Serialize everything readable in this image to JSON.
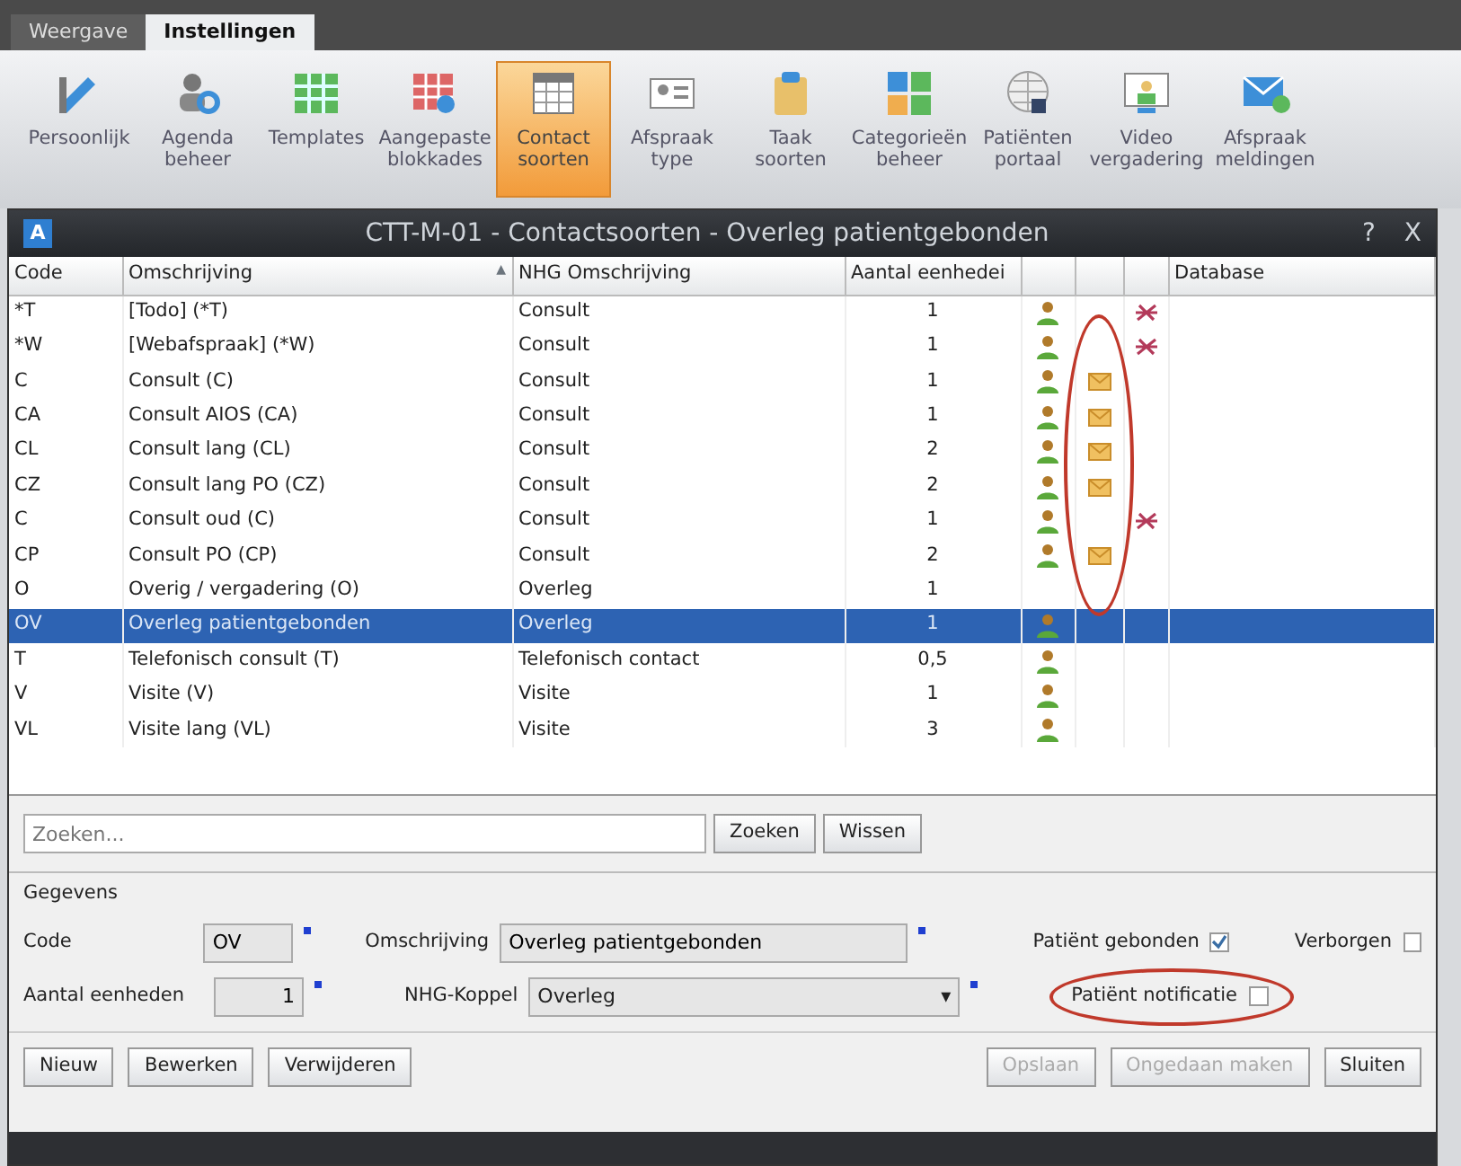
{
  "ribbon": {
    "tabs": [
      {
        "label": "Weergave",
        "selected": false
      },
      {
        "label": "Instellingen",
        "selected": true
      }
    ],
    "items": [
      {
        "label": "Persoonlijk",
        "selected": false
      },
      {
        "label": "Agenda beheer",
        "selected": false
      },
      {
        "label": "Templates",
        "selected": false
      },
      {
        "label": "Aangepaste blokkades",
        "selected": false
      },
      {
        "label": "Contact soorten",
        "selected": true
      },
      {
        "label": "Afspraak type",
        "selected": false
      },
      {
        "label": "Taak soorten",
        "selected": false
      },
      {
        "label": "Categorieën beheer",
        "selected": false
      },
      {
        "label": "Patiënten portaal",
        "selected": false
      },
      {
        "label": "Video vergadering",
        "selected": false
      },
      {
        "label": "Afspraak meldingen",
        "selected": false
      }
    ]
  },
  "dialog": {
    "app_icon": "A",
    "title": "CTT-M-01 - Contactsoorten - Overleg patientgebonden",
    "help": "?",
    "close": "X"
  },
  "table": {
    "columns": [
      {
        "label": "Code"
      },
      {
        "label": "Omschrijving",
        "sort": "▲"
      },
      {
        "label": "NHG Omschrijving"
      },
      {
        "label": "Aantal eenhedei"
      },
      {},
      {},
      {},
      {
        "label": "Database"
      }
    ],
    "rows": [
      {
        "code": "*T",
        "omschrijving": "[Todo] (*T)",
        "nhg": "Consult",
        "aantal": "1",
        "patient": true,
        "mail": false,
        "no_mail": true,
        "selected": false
      },
      {
        "code": "*W",
        "omschrijving": "[Webafspraak] (*W)",
        "nhg": "Consult",
        "aantal": "1",
        "patient": true,
        "mail": false,
        "no_mail": true,
        "selected": false
      },
      {
        "code": "C",
        "omschrijving": "Consult (C)",
        "nhg": "Consult",
        "aantal": "1",
        "patient": true,
        "mail": true,
        "no_mail": false,
        "selected": false
      },
      {
        "code": "CA",
        "omschrijving": "Consult AIOS (CA)",
        "nhg": "Consult",
        "aantal": "1",
        "patient": true,
        "mail": true,
        "no_mail": false,
        "selected": false
      },
      {
        "code": "CL",
        "omschrijving": "Consult lang (CL)",
        "nhg": "Consult",
        "aantal": "2",
        "patient": true,
        "mail": true,
        "no_mail": false,
        "selected": false
      },
      {
        "code": "CZ",
        "omschrijving": "Consult lang PO (CZ)",
        "nhg": "Consult",
        "aantal": "2",
        "patient": true,
        "mail": true,
        "no_mail": false,
        "selected": false
      },
      {
        "code": "C",
        "omschrijving": "Consult oud (C)",
        "nhg": "Consult",
        "aantal": "1",
        "patient": true,
        "mail": false,
        "no_mail": true,
        "selected": false
      },
      {
        "code": "CP",
        "omschrijving": "Consult PO (CP)",
        "nhg": "Consult",
        "aantal": "2",
        "patient": true,
        "mail": true,
        "no_mail": false,
        "selected": false
      },
      {
        "code": "O",
        "omschrijving": "Overig / vergadering (O)",
        "nhg": "Overleg",
        "aantal": "1",
        "patient": false,
        "mail": false,
        "no_mail": false,
        "selected": false
      },
      {
        "code": "OV",
        "omschrijving": "Overleg patientgebonden",
        "nhg": "Overleg",
        "aantal": "1",
        "patient": true,
        "mail": false,
        "no_mail": false,
        "selected": true
      },
      {
        "code": "T",
        "omschrijving": "Telefonisch consult (T)",
        "nhg": "Telefonisch contact",
        "aantal": "0,5",
        "patient": true,
        "mail": false,
        "no_mail": false,
        "selected": false
      },
      {
        "code": "V",
        "omschrijving": "Visite (V)",
        "nhg": "Visite",
        "aantal": "1",
        "patient": true,
        "mail": false,
        "no_mail": false,
        "selected": false
      },
      {
        "code": "VL",
        "omschrijving": "Visite lang (VL)",
        "nhg": "Visite",
        "aantal": "3",
        "patient": true,
        "mail": false,
        "no_mail": false,
        "selected": false
      }
    ]
  },
  "search": {
    "placeholder": "Zoeken...",
    "buttons": [
      "Zoeken",
      "Wissen"
    ]
  },
  "details": {
    "legend": "Gegevens",
    "code": {
      "label": "Code",
      "value": "OV"
    },
    "omschrijving": {
      "label": "Omschrijving",
      "value": "Overleg patientgebonden"
    },
    "aantal": {
      "label": "Aantal eenheden",
      "value": "1"
    },
    "nhg": {
      "label": "NHG-Koppel",
      "value": "Overleg",
      "caret": "▾"
    },
    "checks": [
      {
        "label": "Patiënt gebonden",
        "checked": true
      },
      {
        "label": "Verborgen",
        "checked": false
      },
      {
        "label": "Patiënt notificatie",
        "checked": false
      }
    ]
  },
  "buttons": [
    {
      "label": "Nieuw",
      "disabled": false
    },
    {
      "label": "Bewerken",
      "disabled": false
    },
    {
      "label": "Verwijderen",
      "disabled": false
    },
    {
      "label": "Opslaan",
      "disabled": true
    },
    {
      "label": "Ongedaan maken",
      "disabled": true
    },
    {
      "label": "Sluiten",
      "disabled": false
    }
  ],
  "annotations": [
    {
      "kind": "ellipse",
      "color": "#c0392b"
    },
    {
      "kind": "ellipse",
      "color": "#c0392b"
    }
  ]
}
